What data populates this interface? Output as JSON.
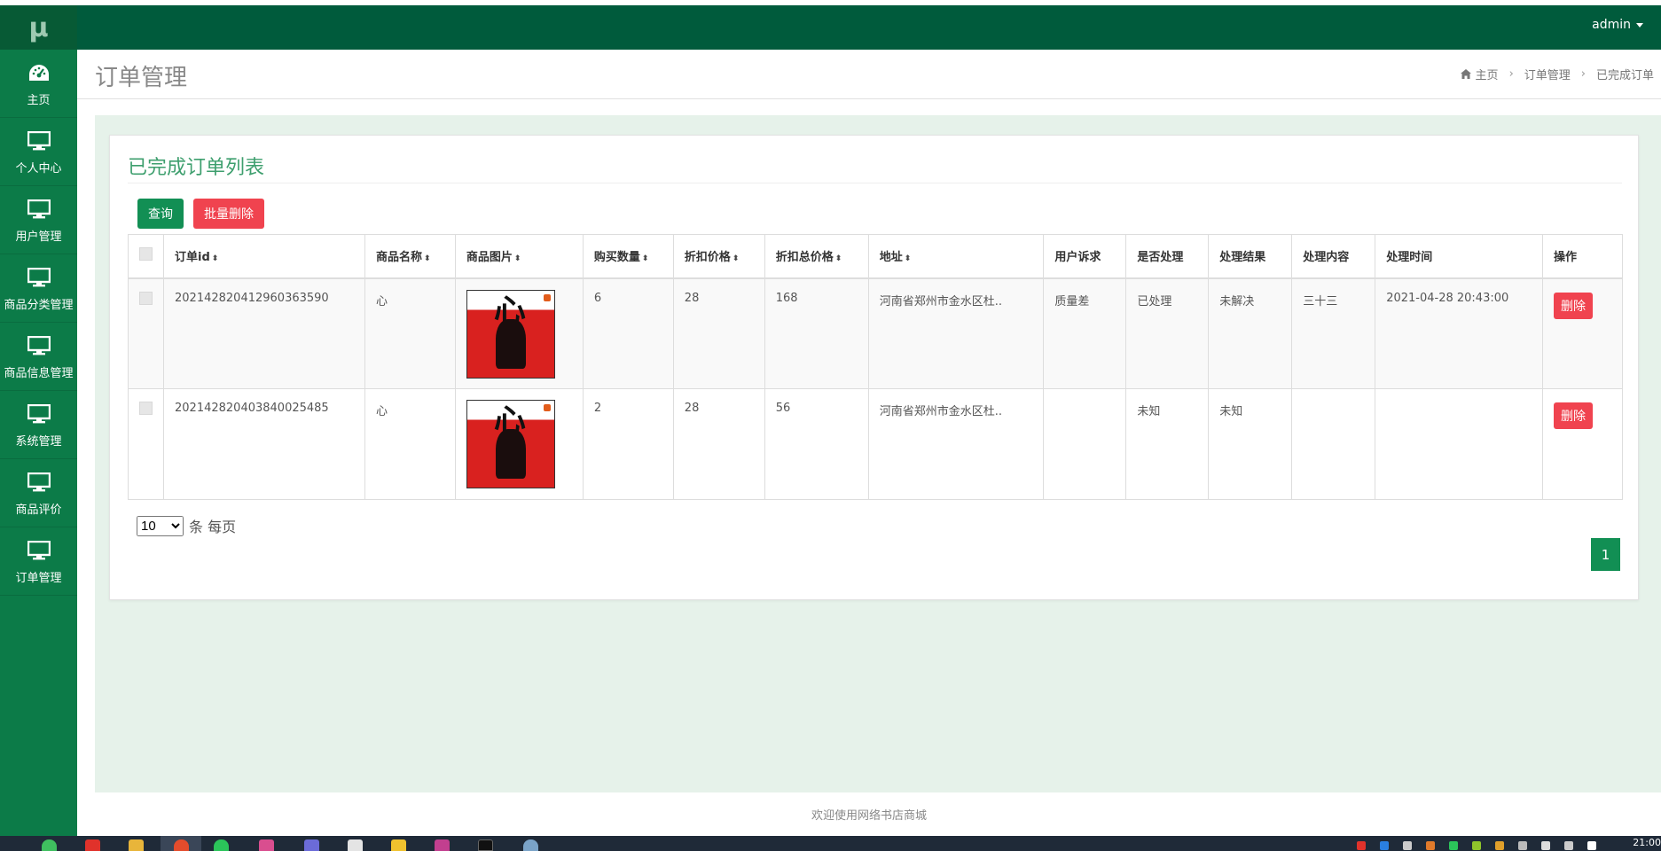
{
  "logo": "μ",
  "sidebar": {
    "items": [
      {
        "label": "主页",
        "icon": "dashboard-icon"
      },
      {
        "label": "个人中心",
        "icon": "monitor-icon"
      },
      {
        "label": "用户管理",
        "icon": "monitor-icon"
      },
      {
        "label": "商品分类管理",
        "icon": "monitor-icon"
      },
      {
        "label": "商品信息管理",
        "icon": "monitor-icon"
      },
      {
        "label": "系统管理",
        "icon": "monitor-icon"
      },
      {
        "label": "商品评价",
        "icon": "monitor-icon"
      },
      {
        "label": "订单管理",
        "icon": "monitor-icon"
      }
    ]
  },
  "topbar": {
    "user": "admin"
  },
  "page": {
    "title": "订单管理",
    "breadcrumb": [
      "主页",
      "订单管理",
      "已完成订单"
    ]
  },
  "card": {
    "title": "已完成订单列表",
    "query_label": "查询",
    "batch_delete_label": "批量删除"
  },
  "table": {
    "headers": [
      {
        "label": "订单id",
        "sortable": true
      },
      {
        "label": "商品名称",
        "sortable": true
      },
      {
        "label": "商品图片",
        "sortable": true
      },
      {
        "label": "购买数量",
        "sortable": true
      },
      {
        "label": "折扣价格",
        "sortable": true
      },
      {
        "label": "折扣总价格",
        "sortable": true
      },
      {
        "label": "地址",
        "sortable": true
      },
      {
        "label": "用户诉求",
        "sortable": false
      },
      {
        "label": "是否处理",
        "sortable": false
      },
      {
        "label": "处理结果",
        "sortable": false
      },
      {
        "label": "处理内容",
        "sortable": false
      },
      {
        "label": "处理时间",
        "sortable": false
      },
      {
        "label": "操作",
        "sortable": false
      }
    ],
    "rows": [
      {
        "order_id": "202142820412960363590",
        "name": "心",
        "quantity": "6",
        "price": "28",
        "total": "168",
        "address": "河南省郑州市金水区杜..",
        "appeal": "质量差",
        "processed": "已处理",
        "result": "未解决",
        "content": "三十三",
        "time": "2021-04-28 20:43:00",
        "delete_label": "删除",
        "image_text": "心"
      },
      {
        "order_id": "202142820403840025485",
        "name": "心",
        "quantity": "2",
        "price": "28",
        "total": "56",
        "address": "河南省郑州市金水区杜..",
        "appeal": "",
        "processed": "未知",
        "result": "未知",
        "content": "",
        "time": "",
        "delete_label": "删除",
        "image_text": "心"
      }
    ]
  },
  "pagination": {
    "page_size": "10",
    "page_size_options": [
      "10"
    ],
    "per_page_label": "条 每页",
    "current_page": "1"
  },
  "footer": "欢迎使用网络书店商城",
  "taskbar": {
    "clock": "21:00"
  },
  "colors": {
    "sidebar": "#0c7b48",
    "topbar": "#005b3c",
    "accent": "#128f54",
    "danger": "#f0434f",
    "content_bg": "#e6f2ea"
  }
}
